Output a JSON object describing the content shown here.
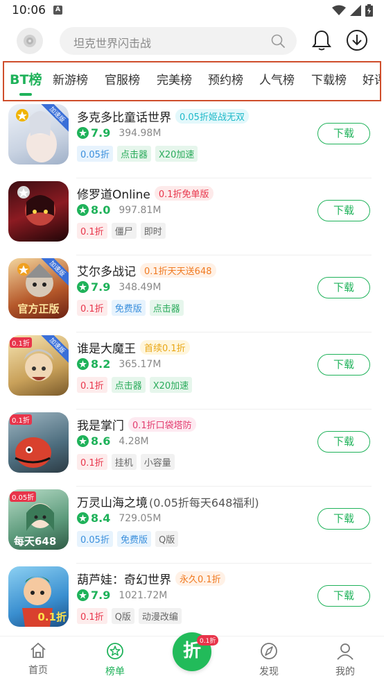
{
  "status_bar": {
    "time": "10:06",
    "notification_letter": "A"
  },
  "search": {
    "placeholder": "坦克世界闪击战"
  },
  "tabs": [
    {
      "label": "BT榜"
    },
    {
      "label": "新游榜"
    },
    {
      "label": "官服榜"
    },
    {
      "label": "完美榜"
    },
    {
      "label": "预约榜"
    },
    {
      "label": "人气榜"
    },
    {
      "label": "下载榜"
    },
    {
      "label": "好评"
    }
  ],
  "games": [
    {
      "title": "多克多比童话世界",
      "tagline": "0.05折姬战无双",
      "rating": "7.9",
      "size": "394.98M",
      "tags": [
        "0.05折",
        "点击器",
        "X20加速"
      ],
      "button": "下载",
      "icon": {
        "corner": "加速版",
        "overlay": ""
      }
    },
    {
      "title": "修罗道Online",
      "tagline": "0.1折免单版",
      "rating": "8.0",
      "size": "997.81M",
      "tags": [
        "0.1折",
        "僵尸",
        "即时"
      ],
      "button": "下载",
      "icon": {
        "corner": "",
        "overlay": ""
      }
    },
    {
      "title": "艾尔多战记",
      "tagline": "0.1折天天送648",
      "rating": "7.9",
      "size": "348.49M",
      "tags": [
        "0.1折",
        "免费版",
        "点击器"
      ],
      "button": "下载",
      "icon": {
        "corner": "加速版",
        "overlay": "官方正版"
      }
    },
    {
      "title": "谁是大魔王",
      "tagline": "首续0.1折",
      "rating": "8.2",
      "size": "365.17M",
      "tags": [
        "0.1折",
        "点击器",
        "X20加速"
      ],
      "button": "下载",
      "icon": {
        "corner": "加速版",
        "overlay": "0.1折"
      }
    },
    {
      "title": "我是掌门",
      "tagline": "0.1折口袋塔防",
      "rating": "8.6",
      "size": "4.28M",
      "tags": [
        "0.1折",
        "挂机",
        "小容量"
      ],
      "button": "下载",
      "icon": {
        "corner": "",
        "overlay": "0.1折"
      }
    },
    {
      "title": "万灵山海之境",
      "tagline": "(0.05折每天648福利)",
      "rating": "8.4",
      "size": "729.05M",
      "tags": [
        "0.05折",
        "免费版",
        "Q版"
      ],
      "button": "下载",
      "icon": {
        "corner": "",
        "overlay": "0.05折"
      }
    },
    {
      "title": "葫芦娃：奇幻世界",
      "tagline": "永久0.1折",
      "rating": "7.9",
      "size": "1021.72M",
      "tags": [
        "0.1折",
        "Q版",
        "动漫改编"
      ],
      "button": "下载",
      "icon": {
        "corner": "",
        "overlay": "0.1折"
      }
    }
  ],
  "bottom_nav": {
    "items": [
      {
        "label": "首页",
        "icon": "home-icon"
      },
      {
        "label": "榜单",
        "icon": "ranking-star-icon"
      },
      {
        "label": "发现",
        "icon": "discover-icon"
      },
      {
        "label": "我的",
        "icon": "profile-icon"
      }
    ],
    "center": {
      "label": "折",
      "badge": "0.1折"
    }
  },
  "colors": {
    "accent": "#1fb25a",
    "tab_highlight_border": "#cf4d2b"
  }
}
